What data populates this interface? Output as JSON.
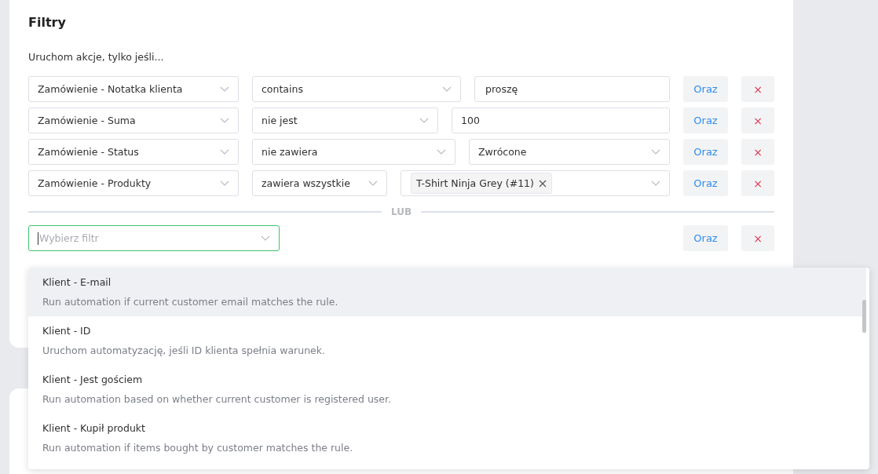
{
  "card": {
    "title": "Filtry",
    "subtitle": "Uruchom akcje, tylko jeśli..."
  },
  "conditions": [
    {
      "field": "Zamówienie - Notatka klienta",
      "operator": "contains",
      "value": {
        "kind": "input",
        "text": "proszę"
      },
      "and_label": "Oraz",
      "remove_label": "×"
    },
    {
      "field": "Zamówienie - Suma",
      "operator": "nie jest",
      "value": {
        "kind": "input",
        "text": "100"
      },
      "and_label": "Oraz",
      "remove_label": "×"
    },
    {
      "field": "Zamówienie - Status",
      "operator": "nie zawiera",
      "value": {
        "kind": "select",
        "text": "Zwrócone"
      },
      "and_label": "Oraz",
      "remove_label": "×"
    },
    {
      "field": "Zamówienie - Produkty",
      "operator": "zawiera wszystkie",
      "value": {
        "kind": "tags",
        "tags": [
          "T-Shirt Ninja Grey (#11)"
        ]
      },
      "and_label": "Oraz",
      "remove_label": "×"
    }
  ],
  "separator": "LUB",
  "new_filter": {
    "placeholder": "Wybierz filtr",
    "focused": true,
    "and_label": "Oraz",
    "remove_label": "×"
  },
  "dropdown": {
    "items": [
      {
        "title": "Klient - E-mail",
        "description": "Run automation if current customer email matches the rule.",
        "highlighted": true
      },
      {
        "title": "Klient - ID",
        "description": "Uruchom automatyzację, jeśli ID klienta spełnia warunek.",
        "highlighted": false
      },
      {
        "title": "Klient - Jest gościem",
        "description": "Run automation based on whether current customer is registered user.",
        "highlighted": false
      },
      {
        "title": "Klient - Kupił produkt",
        "description": "Run automation if items bought by customer matches the rule.",
        "highlighted": false
      }
    ]
  }
}
